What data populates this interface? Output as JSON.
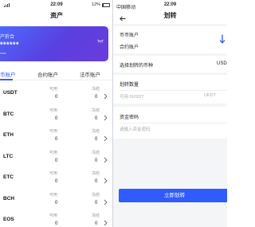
{
  "left_screen": {
    "status": {
      "carrier": "ll",
      "time": "22:09",
      "battery": "12%",
      "battery_level": 0.12
    },
    "title": "资产",
    "card": {
      "label": "产折合",
      "value": "******",
      "sub": "****"
    },
    "tabs": [
      {
        "label": "币账户",
        "active": true
      },
      {
        "label": "合约账户",
        "active": false
      },
      {
        "label": "法币账户",
        "active": false
      }
    ],
    "coins": [
      {
        "name": "USDT",
        "available_label": "可用",
        "available": "0",
        "frozen_label": "冻结",
        "frozen": "0"
      },
      {
        "name": "BTC",
        "available_label": "可用",
        "available": "0",
        "frozen_label": "冻结",
        "frozen": "0"
      },
      {
        "name": "ETH",
        "available_label": "可用",
        "available": "0",
        "frozen_label": "冻结",
        "frozen": "0"
      },
      {
        "name": "LTC",
        "available_label": "可用",
        "available": "0",
        "frozen_label": "冻结",
        "frozen": "0"
      },
      {
        "name": "ETC",
        "available_label": "可用",
        "available": "0",
        "frozen_label": "冻结",
        "frozen": "0"
      },
      {
        "name": "BCH",
        "available_label": "可用",
        "available": "0",
        "frozen_label": "冻结",
        "frozen": "0"
      },
      {
        "name": "EOS",
        "available_label": "可用",
        "available": "0",
        "frozen_label": "冻结",
        "frozen": "0"
      }
    ]
  },
  "right_screen": {
    "status": {
      "carrier": "中国移动",
      "time": "22:09"
    },
    "title": "划转",
    "from_account": "币币账户",
    "to_account": "合约账户",
    "coin_select_label": "选择划转的币种",
    "coin_select_value": "USD",
    "amount_label": "划转数量",
    "amount_available": "可用 0USDT",
    "amount_unit": "UKDT",
    "password_label": "资金密码",
    "password_placeholder": "请输入资金密码",
    "submit_label": "立即划转",
    "accent": "#2f5bff"
  }
}
